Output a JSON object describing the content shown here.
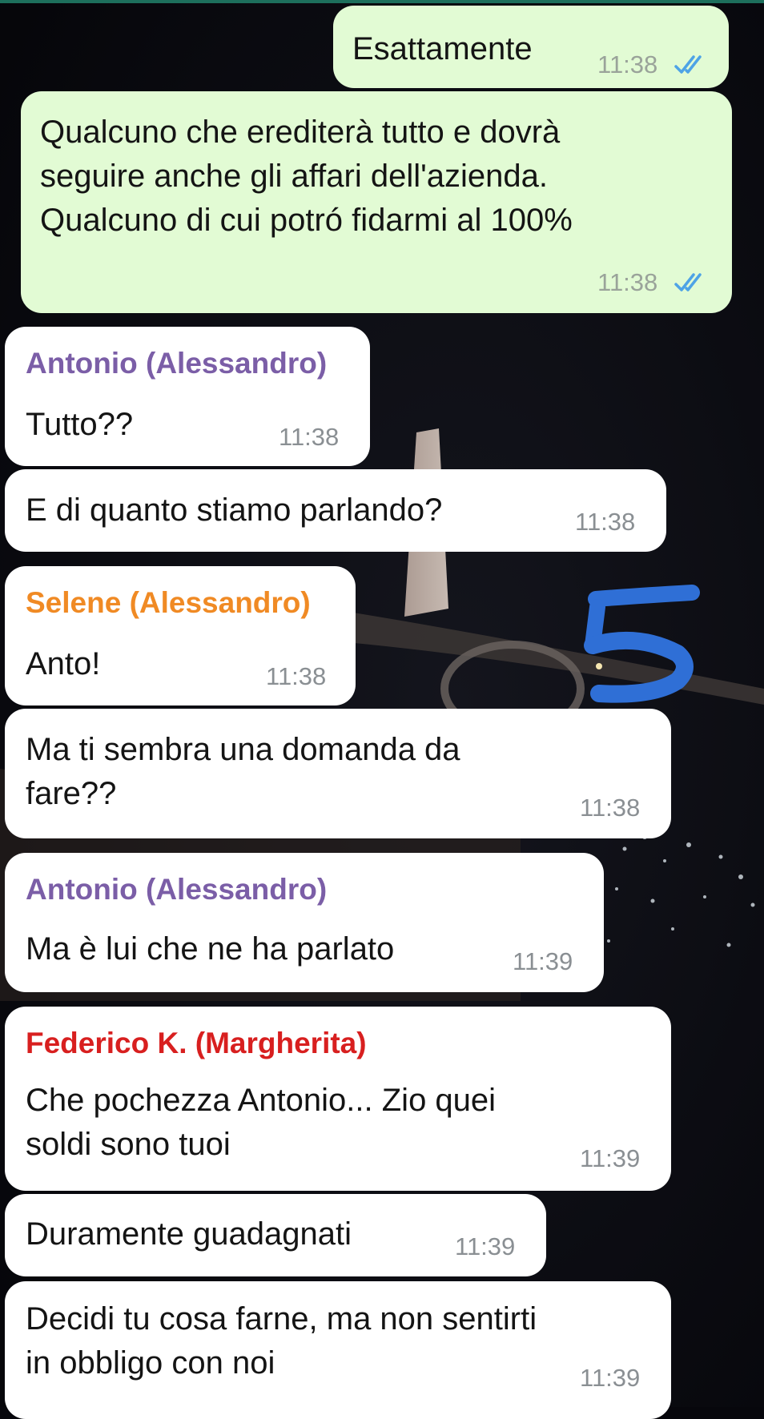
{
  "colors": {
    "outgoing_bubble": "#e2fbd4",
    "incoming_bubble": "#ffffff",
    "tick_read": "#4ea3e6",
    "sender_antonio": "#7b5ea7",
    "sender_selene": "#f08a24",
    "sender_federico": "#d81f1f",
    "annotation_marker": "#2f6fd6"
  },
  "messages": [
    {
      "direction": "out",
      "text": "Esattamente",
      "time": "11:38",
      "status": "read-double-check-icon"
    },
    {
      "direction": "out",
      "text": "Qualcuno che erediterà tutto e dovrà\nseguire anche gli affari dell'azienda.\nQualcuno di cui potró fidarmi al 100%",
      "time": "11:38",
      "status": "read-double-check-icon"
    },
    {
      "direction": "in",
      "sender": "Antonio (Alessandro)",
      "text": "Tutto??",
      "time": "11:38"
    },
    {
      "direction": "in",
      "text": "E di quanto stiamo parlando?",
      "time": "11:38"
    },
    {
      "direction": "in",
      "sender": "Selene (Alessandro)",
      "text": "Anto!",
      "time": "11:38"
    },
    {
      "direction": "in",
      "text": "Ma ti sembra una domanda da\nfare??",
      "time": "11:38"
    },
    {
      "direction": "in",
      "sender": "Antonio (Alessandro)",
      "text": "Ma è lui che ne ha parlato",
      "time": "11:39"
    },
    {
      "direction": "in",
      "sender": "Federico K. (Margherita)",
      "text": "Che pochezza Antonio... Zio quei\nsoldi sono tuoi",
      "time": "11:39"
    },
    {
      "direction": "in",
      "text": "Duramente guadagnati",
      "time": "11:39"
    },
    {
      "direction": "in",
      "text": "Decidi tu cosa farne, ma non sentirti\nin obbligo con noi",
      "time": "11:39"
    }
  ],
  "annotation": {
    "icon": "handwritten-5-marker",
    "stroke_color": "#2f6fd6"
  }
}
